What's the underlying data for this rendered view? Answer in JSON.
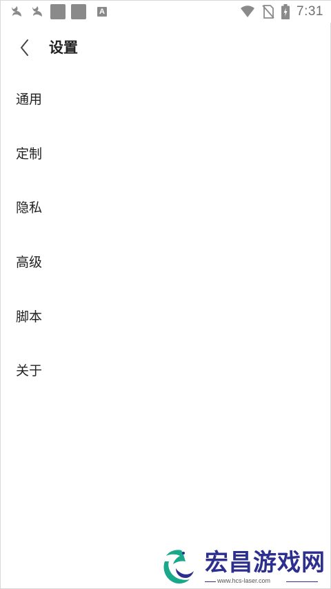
{
  "status_bar": {
    "time": "7:31",
    "left_icons": [
      "uc-browser-icon",
      "uc-browser-icon",
      "notification-square-icon",
      "notification-square-icon",
      "a-keyboard-icon"
    ],
    "right_icons": [
      "wifi-icon",
      "no-sim-icon",
      "battery-charging-icon"
    ],
    "a_badge": "A"
  },
  "app_bar": {
    "title": "设置",
    "back_icon": "chevron-left-icon"
  },
  "settings": {
    "items": [
      {
        "label": "通用"
      },
      {
        "label": "定制"
      },
      {
        "label": "隐私"
      },
      {
        "label": "高级"
      },
      {
        "label": "脚本"
      },
      {
        "label": "关于"
      }
    ]
  },
  "watermark": {
    "brand": "宏昌游戏网",
    "url": "www.hcs-laser.com"
  },
  "colors": {
    "background": "#ffffff",
    "text": "#222222",
    "status_icons": "#8a8a8a",
    "watermark_text": "#2c2f8e",
    "watermark_logo": "#1aa88a"
  }
}
